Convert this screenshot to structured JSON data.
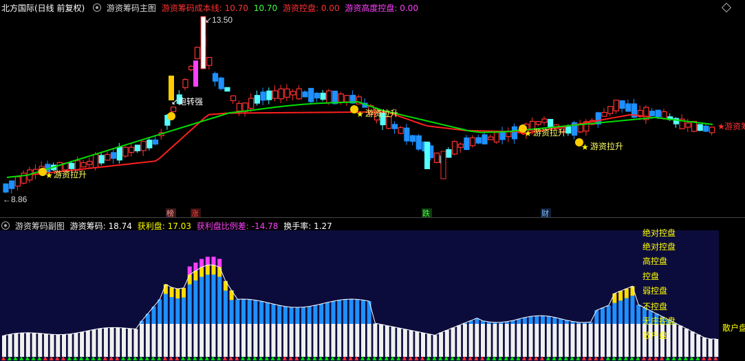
{
  "main_header": {
    "stock": "北方国际(日线 前复权)",
    "indicator": "游资筹码主图",
    "cost_label": "游资筹码成本线:",
    "cost_value": "10.70",
    "cost_value2": "10.70",
    "control_label": "游资控盘:",
    "control_value": "0.00",
    "high_control_label": "游资高度控盘:",
    "high_control_value": "0.00"
  },
  "sub_header": {
    "indicator": "游资筹码副图",
    "chips_label": "游资筹码:",
    "chips_value": "18.74",
    "profit_label": "获利盘:",
    "profit_value": "17.03",
    "ratio_label": "获利盘比例差:",
    "ratio_value": "-14.78",
    "turnover_label": "换手率:",
    "turnover_value": "1.27"
  },
  "annotations": {
    "high_price": "13.50",
    "low_price": "8.86",
    "signal_1": "游资拉升",
    "signal_2": "游资拉升",
    "signal_3": "游资拉升",
    "signal_4": "游资拉升",
    "signal_strong": "跑转强",
    "signal_right": "游资筹",
    "tag_bang": "榜",
    "tag_zhang": "涨",
    "tag_die": "跌",
    "tag_cai": "财"
  },
  "sub_levels": {
    "top_cut": "绝对控盘",
    "absolute": "绝对控盘",
    "high": "高控盘",
    "control": "控盘",
    "weak": "弱控盘",
    "none": "不控盘",
    "no_main": "无庄控盘",
    "retail": "散户盘",
    "retail_right": "散户盘"
  },
  "colors": {
    "up": "#ff3232",
    "down": "#54ffff",
    "blue": "#1e90ff",
    "cost_line_red": "#ff2020",
    "cost_line_green": "#00e000",
    "yellow": "#ffff00",
    "magenta": "#ff00ff",
    "white": "#ffffff",
    "sub_bg": "#0c0c3c"
  },
  "icons": [
    "smiley-icon",
    "star-icon",
    "money-bag-icon",
    "gear-icon",
    "diamond-icon"
  ]
}
